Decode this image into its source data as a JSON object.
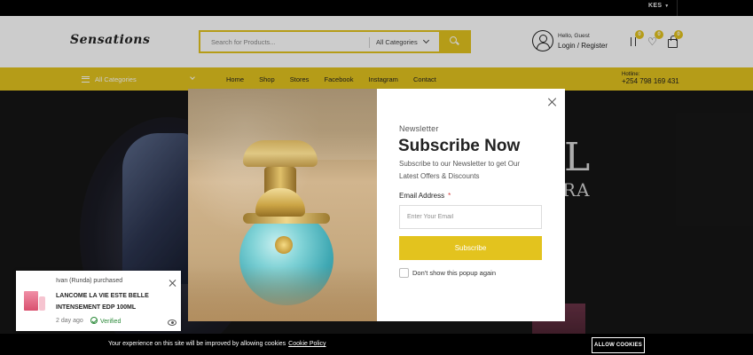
{
  "topbar": {
    "currency": "KES"
  },
  "header": {
    "logo": "Sensations",
    "search": {
      "placeholder": "Search for Products...",
      "category": "All Categories"
    },
    "account": {
      "greeting": "Hello, Guest",
      "login": "Login / Register"
    },
    "badges": {
      "compare": "0",
      "wishlist": "0",
      "cart": "0"
    }
  },
  "nav": {
    "all_categories": "All Categories",
    "links": [
      "Home",
      "Shop",
      "Stores",
      "Facebook",
      "Instagram",
      "Contact"
    ],
    "hotline_label": "Hotline:",
    "hotline_number": "+254 798 169 431"
  },
  "hero": {
    "big_letter": "L",
    "partial_text": "RA"
  },
  "newsletter": {
    "eyebrow": "Newsletter",
    "title": "Subscribe Now",
    "description": "Subscribe to our Newsletter to get Our Latest Offers & Discounts",
    "email_label": "Email Address",
    "required_mark": "*",
    "email_placeholder": "Enter Your Email",
    "email_value": "",
    "subscribe_label": "Subscribe",
    "dont_show_label": "Don't show this popup again",
    "dont_show_checked": false
  },
  "notification": {
    "who": "Ivan (Runda) purchased",
    "product": "LANCOME LA VIE ESTE BELLE INTENSEMENT EDP 100ML",
    "ago": "2 day ago",
    "verified": "Verified"
  },
  "cookie": {
    "message": "Your experience on this site will be improved by allowing cookies",
    "policy_link": "Cookie Policy",
    "allow_label": "ALLOW COOKIES"
  },
  "colors": {
    "accent": "#e3c31e",
    "dark": "#000000",
    "required": "#d43a3a",
    "verified": "#2c8a3a"
  },
  "icons": [
    "search-icon",
    "user-icon",
    "compare-icon",
    "heart-icon",
    "cart-icon",
    "menu-icon",
    "close-icon",
    "checkmark-icon",
    "eye-icon"
  ]
}
